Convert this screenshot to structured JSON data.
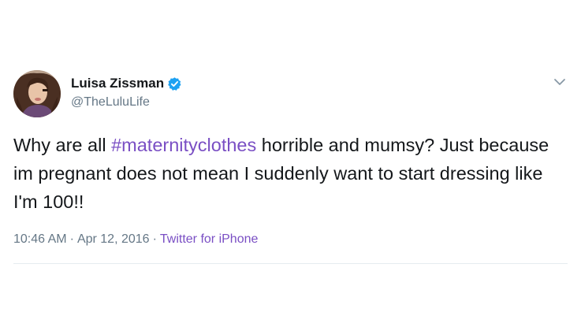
{
  "user": {
    "display_name": "Luisa Zissman",
    "handle": "@TheLuluLife",
    "verified": true,
    "avatar_icon": "profile-photo"
  },
  "tweet": {
    "text_before": "Why are all ",
    "hashtag": "#maternityclothes",
    "text_after": " horrible and mumsy? Just because im pregnant does not mean I suddenly want to start dressing like I'm 100!!",
    "time": "10:46 AM",
    "separator": "·",
    "date": "Apr 12, 2016",
    "source": "Twitter for iPhone"
  },
  "icons": {
    "verified": "verified-badge-icon",
    "menu": "chevron-down-icon"
  },
  "colors": {
    "hashtag": "#7a4fc4",
    "verified": "#1da1f2",
    "meta": "#657786"
  }
}
